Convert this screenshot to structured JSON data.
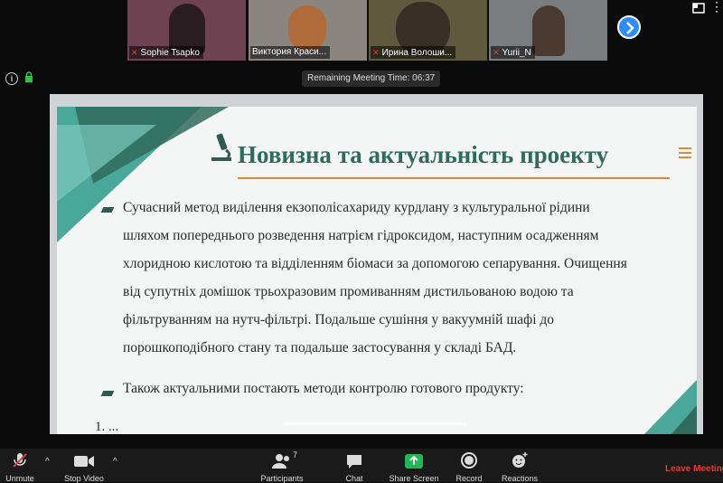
{
  "participants_strip": [
    {
      "name": "Sophie Tsapko",
      "bg": "#6e4250"
    },
    {
      "name": "Виктория Краси...",
      "bg": "#8a8580"
    },
    {
      "name": "Ирина Волоши...",
      "bg": "#5f5a3e"
    },
    {
      "name": "Yurii_N",
      "bg": "#7a7d80"
    }
  ],
  "meeting_timer": "Remaining Meeting Time: 06:37",
  "slide": {
    "title": "Новизна та актуальність проекту",
    "paragraph_lines": [
      "Сучасний метод виділення  екзополісахариду курдлану з культуральної рідини",
      "шляхом попереднього розведення натрієм гідроксидом, наступним осадженням",
      "хлоридною кислотою та відділенням біомаси за допомогою сепарування. Очищення",
      "від супутніх домішок трьохразовим промиванням дистильованою водою та",
      "фільтруванням на нутч-фільтрі. Подальше сушіння у вакуумній шафі до",
      "порошкоподібного стану та подальше застосування у складі БАД."
    ],
    "bullet2": "Також актуальними постають методи контролю готового продукту:",
    "item_partial": "1.       ..."
  },
  "toolbar": {
    "unmute": "Unmute",
    "stop_video": "Stop Video",
    "participants": "Participants",
    "participants_count": "7",
    "chat": "Chat",
    "share_screen": "Share Screen",
    "record": "Record",
    "reactions": "Reactions",
    "leave": "Leave Meeting"
  },
  "colors": {
    "accent": "#2d8cff",
    "share": "#1db954",
    "leave": "#e23b3b",
    "title": "#2f6b5c",
    "rule": "#e08b3c"
  }
}
